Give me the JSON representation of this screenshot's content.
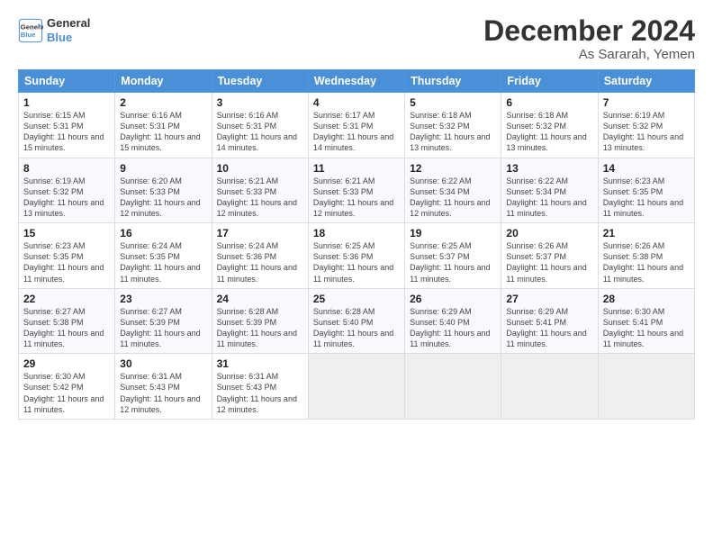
{
  "logo": {
    "line1": "General",
    "line2": "Blue"
  },
  "title": "December 2024",
  "subtitle": "As Sararah, Yemen",
  "weekdays": [
    "Sunday",
    "Monday",
    "Tuesday",
    "Wednesday",
    "Thursday",
    "Friday",
    "Saturday"
  ],
  "weeks": [
    [
      {
        "day": 1,
        "sunrise": "6:15 AM",
        "sunset": "5:31 PM",
        "daylight": "11 hours and 15 minutes."
      },
      {
        "day": 2,
        "sunrise": "6:16 AM",
        "sunset": "5:31 PM",
        "daylight": "11 hours and 15 minutes."
      },
      {
        "day": 3,
        "sunrise": "6:16 AM",
        "sunset": "5:31 PM",
        "daylight": "11 hours and 14 minutes."
      },
      {
        "day": 4,
        "sunrise": "6:17 AM",
        "sunset": "5:31 PM",
        "daylight": "11 hours and 14 minutes."
      },
      {
        "day": 5,
        "sunrise": "6:18 AM",
        "sunset": "5:32 PM",
        "daylight": "11 hours and 13 minutes."
      },
      {
        "day": 6,
        "sunrise": "6:18 AM",
        "sunset": "5:32 PM",
        "daylight": "11 hours and 13 minutes."
      },
      {
        "day": 7,
        "sunrise": "6:19 AM",
        "sunset": "5:32 PM",
        "daylight": "11 hours and 13 minutes."
      }
    ],
    [
      {
        "day": 8,
        "sunrise": "6:19 AM",
        "sunset": "5:32 PM",
        "daylight": "11 hours and 13 minutes."
      },
      {
        "day": 9,
        "sunrise": "6:20 AM",
        "sunset": "5:33 PM",
        "daylight": "11 hours and 12 minutes."
      },
      {
        "day": 10,
        "sunrise": "6:21 AM",
        "sunset": "5:33 PM",
        "daylight": "11 hours and 12 minutes."
      },
      {
        "day": 11,
        "sunrise": "6:21 AM",
        "sunset": "5:33 PM",
        "daylight": "11 hours and 12 minutes."
      },
      {
        "day": 12,
        "sunrise": "6:22 AM",
        "sunset": "5:34 PM",
        "daylight": "11 hours and 12 minutes."
      },
      {
        "day": 13,
        "sunrise": "6:22 AM",
        "sunset": "5:34 PM",
        "daylight": "11 hours and 11 minutes."
      },
      {
        "day": 14,
        "sunrise": "6:23 AM",
        "sunset": "5:35 PM",
        "daylight": "11 hours and 11 minutes."
      }
    ],
    [
      {
        "day": 15,
        "sunrise": "6:23 AM",
        "sunset": "5:35 PM",
        "daylight": "11 hours and 11 minutes."
      },
      {
        "day": 16,
        "sunrise": "6:24 AM",
        "sunset": "5:35 PM",
        "daylight": "11 hours and 11 minutes."
      },
      {
        "day": 17,
        "sunrise": "6:24 AM",
        "sunset": "5:36 PM",
        "daylight": "11 hours and 11 minutes."
      },
      {
        "day": 18,
        "sunrise": "6:25 AM",
        "sunset": "5:36 PM",
        "daylight": "11 hours and 11 minutes."
      },
      {
        "day": 19,
        "sunrise": "6:25 AM",
        "sunset": "5:37 PM",
        "daylight": "11 hours and 11 minutes."
      },
      {
        "day": 20,
        "sunrise": "6:26 AM",
        "sunset": "5:37 PM",
        "daylight": "11 hours and 11 minutes."
      },
      {
        "day": 21,
        "sunrise": "6:26 AM",
        "sunset": "5:38 PM",
        "daylight": "11 hours and 11 minutes."
      }
    ],
    [
      {
        "day": 22,
        "sunrise": "6:27 AM",
        "sunset": "5:38 PM",
        "daylight": "11 hours and 11 minutes."
      },
      {
        "day": 23,
        "sunrise": "6:27 AM",
        "sunset": "5:39 PM",
        "daylight": "11 hours and 11 minutes."
      },
      {
        "day": 24,
        "sunrise": "6:28 AM",
        "sunset": "5:39 PM",
        "daylight": "11 hours and 11 minutes."
      },
      {
        "day": 25,
        "sunrise": "6:28 AM",
        "sunset": "5:40 PM",
        "daylight": "11 hours and 11 minutes."
      },
      {
        "day": 26,
        "sunrise": "6:29 AM",
        "sunset": "5:40 PM",
        "daylight": "11 hours and 11 minutes."
      },
      {
        "day": 27,
        "sunrise": "6:29 AM",
        "sunset": "5:41 PM",
        "daylight": "11 hours and 11 minutes."
      },
      {
        "day": 28,
        "sunrise": "6:30 AM",
        "sunset": "5:41 PM",
        "daylight": "11 hours and 11 minutes."
      }
    ],
    [
      {
        "day": 29,
        "sunrise": "6:30 AM",
        "sunset": "5:42 PM",
        "daylight": "11 hours and 11 minutes."
      },
      {
        "day": 30,
        "sunrise": "6:31 AM",
        "sunset": "5:43 PM",
        "daylight": "11 hours and 12 minutes."
      },
      {
        "day": 31,
        "sunrise": "6:31 AM",
        "sunset": "5:43 PM",
        "daylight": "11 hours and 12 minutes."
      },
      null,
      null,
      null,
      null
    ]
  ]
}
